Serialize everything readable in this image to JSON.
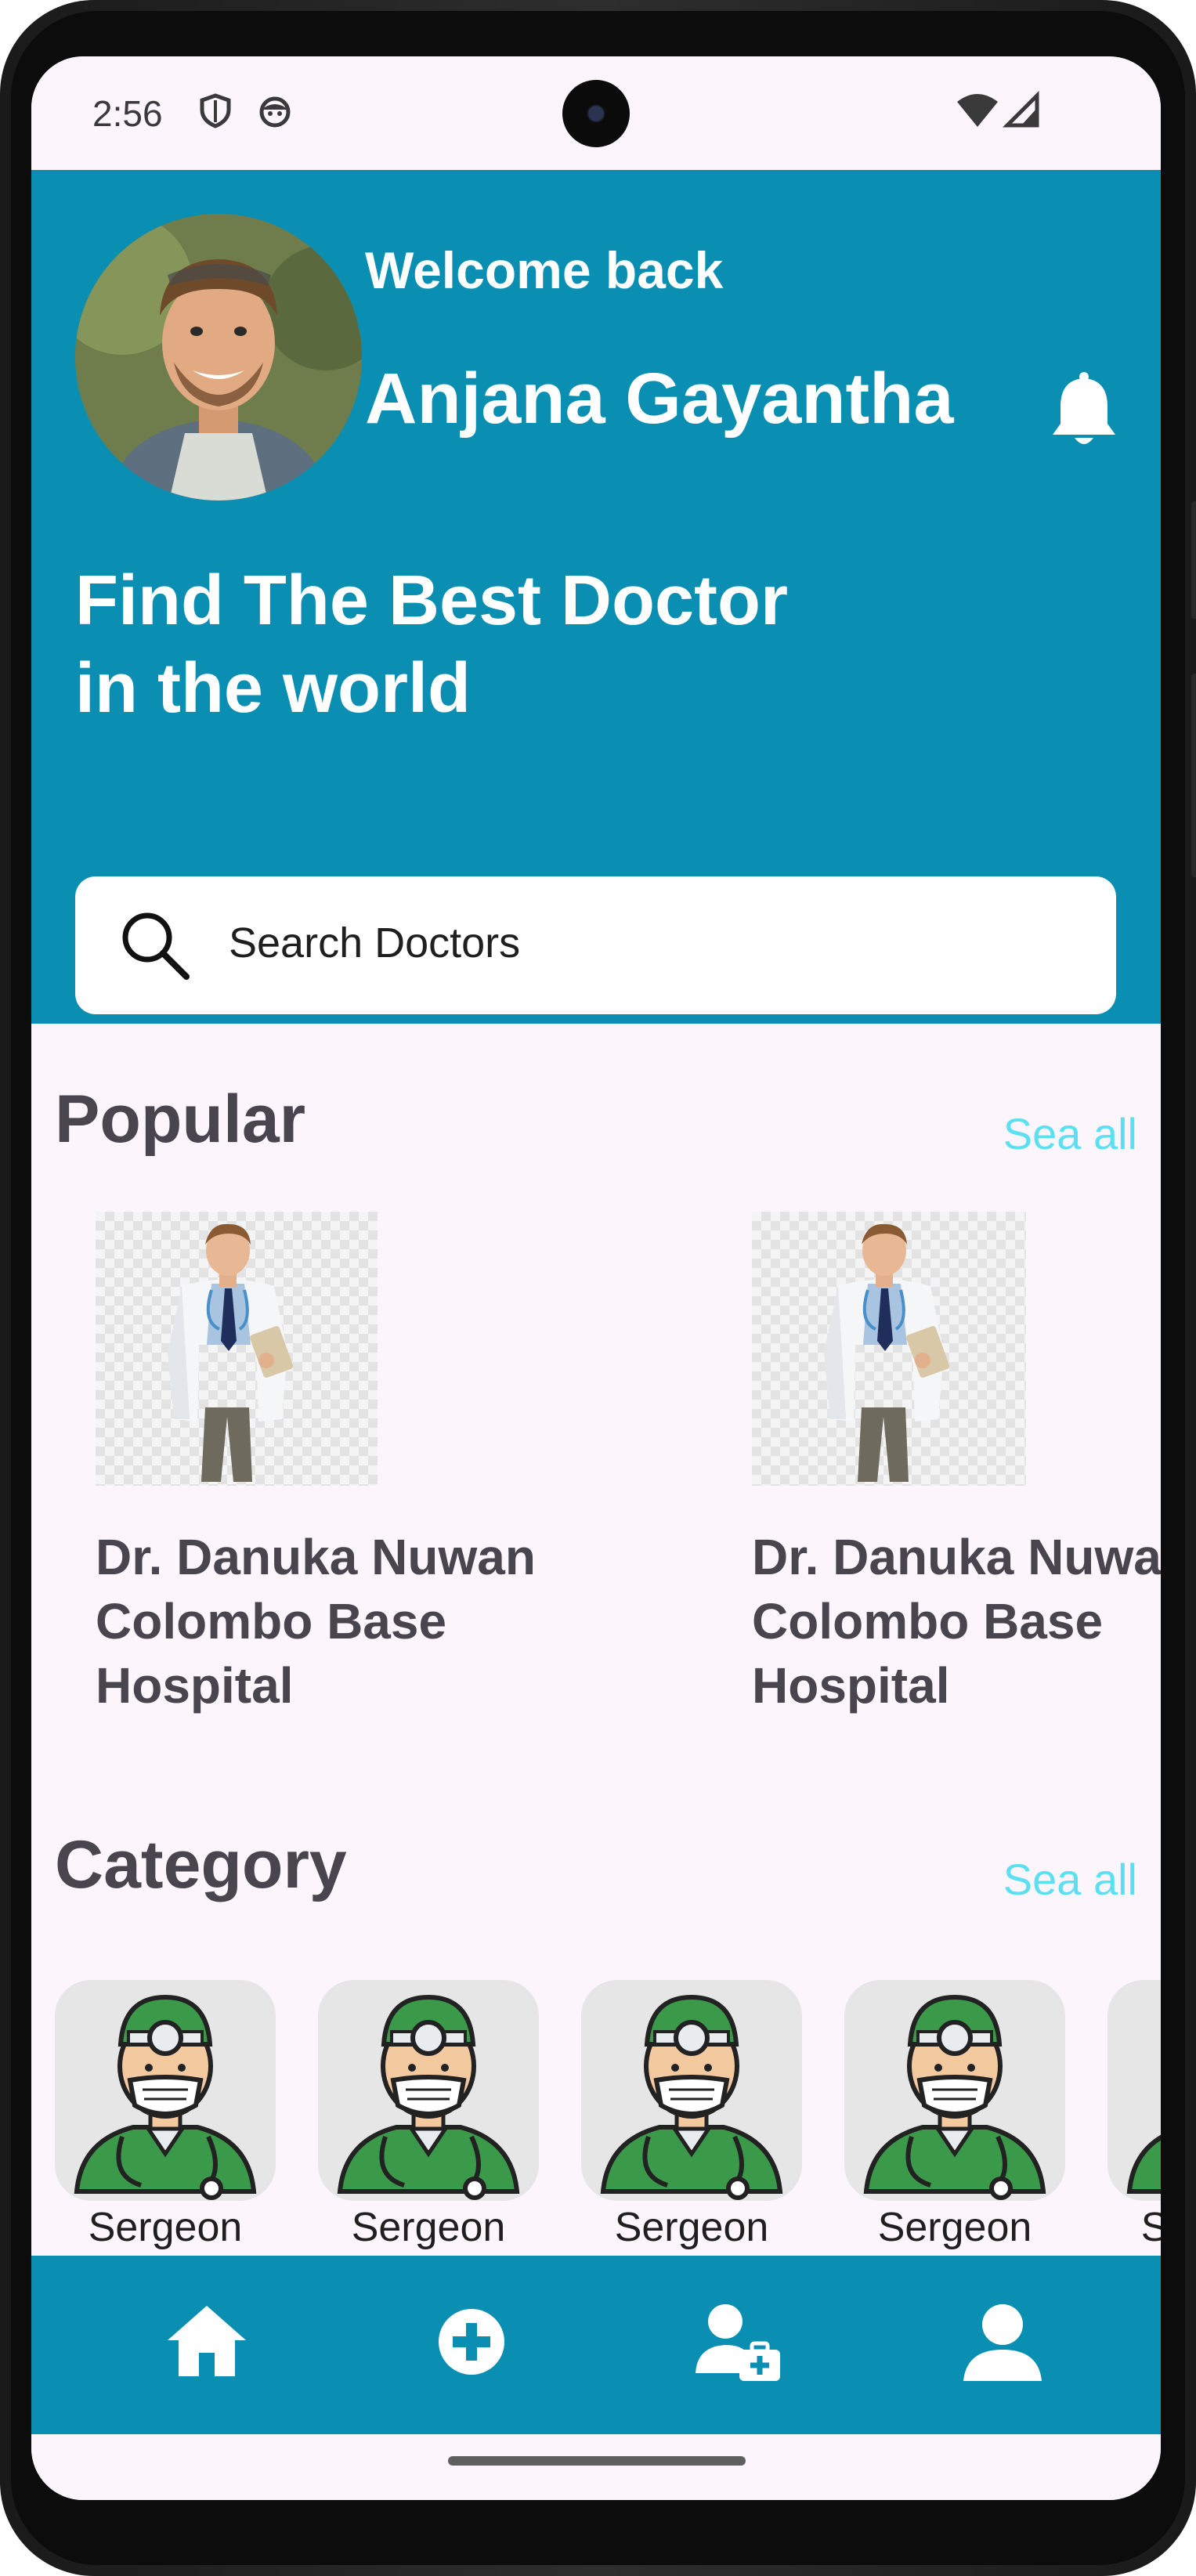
{
  "status_bar": {
    "time": "2:56",
    "icons": [
      "shield-icon",
      "android-face-icon",
      "wifi-icon",
      "signal-icon"
    ]
  },
  "header": {
    "welcome": "Welcome back",
    "user_name": "Anjana Gayantha",
    "hero_line1": "Find The Best Doctor",
    "hero_line2": "in the world",
    "search_placeholder": "Search Doctors",
    "background_color": "#0a8fb2"
  },
  "popular": {
    "title": "Popular",
    "see_all": "Sea all",
    "doctors": [
      {
        "name": "Dr. Danuka Nuwan",
        "hospital": "Colombo Base Hospital"
      },
      {
        "name": "Dr. Danuka Nuwan",
        "hospital": "Colombo Base Hospital"
      }
    ]
  },
  "category": {
    "title": "Category",
    "see_all": "Sea all",
    "items": [
      {
        "label": "Sergeon"
      },
      {
        "label": "Sergeon"
      },
      {
        "label": "Sergeon"
      },
      {
        "label": "Sergeon"
      },
      {
        "label": "Sergeon"
      }
    ]
  },
  "bottom_nav": {
    "items": [
      "home-icon",
      "add-circle-icon",
      "doctor-kit-icon",
      "profile-icon"
    ],
    "background_color": "#0a8fb2"
  },
  "colors": {
    "accent": "#0a8fb2",
    "see_all": "#5ae0f0",
    "surface": "#fcf5fb"
  }
}
